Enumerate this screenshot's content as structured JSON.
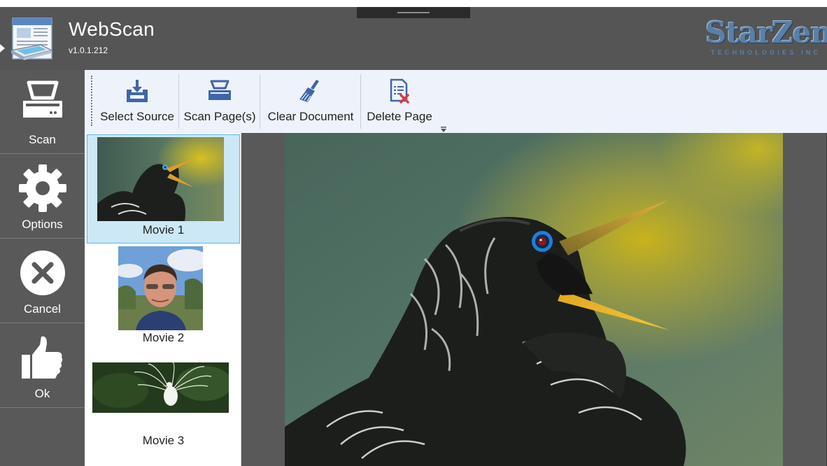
{
  "header": {
    "title": "WebScan",
    "version": "v1.0.1.212",
    "brand_name": "StarZen",
    "brand_sub": "TECHNOLOGIES INC"
  },
  "nav": {
    "items": [
      {
        "label": "Scan",
        "icon": "scanner-icon"
      },
      {
        "label": "Options",
        "icon": "gear-icon"
      },
      {
        "label": "Cancel",
        "icon": "close-circle-icon"
      },
      {
        "label": "Ok",
        "icon": "thumbs-up-icon"
      }
    ]
  },
  "toolbar": {
    "items": [
      {
        "label": "Select Source",
        "icon": "download-tray-icon"
      },
      {
        "label": "Scan Page(s)",
        "icon": "scanner-icon"
      },
      {
        "label": "Clear Document",
        "icon": "broom-icon"
      },
      {
        "label": "Delete Page",
        "icon": "delete-page-icon"
      }
    ]
  },
  "pages": {
    "items": [
      {
        "label": "Movie 1",
        "selected": true
      },
      {
        "label": "Movie 2",
        "selected": false
      },
      {
        "label": "Movie 3",
        "selected": false
      }
    ]
  },
  "colors": {
    "header_bg": "#555555",
    "toolbar_bg": "#eef3fb",
    "selection_bg": "#cce8f7",
    "selection_border": "#5fb4e4",
    "toolbar_icon": "#3f66a8"
  }
}
